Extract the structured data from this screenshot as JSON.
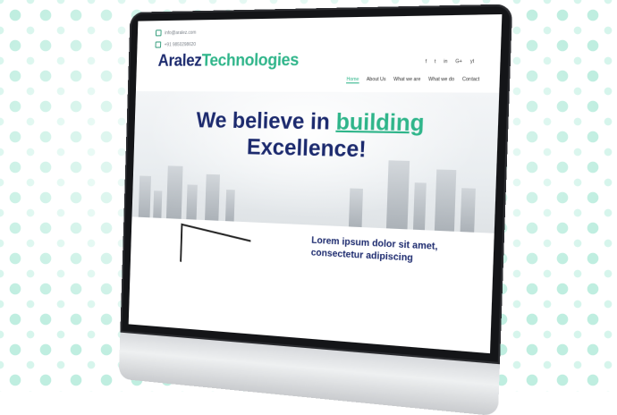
{
  "site": {
    "topbar": {
      "email": "info@aralez.com",
      "phone": "+91 9850298620"
    },
    "logo": {
      "part1": "Aralez",
      "part2": "Technologies"
    },
    "social": [
      "f",
      "t",
      "in",
      "G+",
      "yt"
    ],
    "nav": [
      "Home",
      "About Us",
      "What we are",
      "What we do",
      "Contact"
    ],
    "hero": {
      "line1_prefix": "We believe in ",
      "line1_highlight": "building",
      "line2": "Excellence!"
    },
    "section": {
      "heading": "Lorem ipsum dolor sit amet, consectetur adipiscing"
    }
  },
  "colors": {
    "navy": "#1c2a6e",
    "green": "#2fb58a",
    "dots": "#bfeee0"
  }
}
